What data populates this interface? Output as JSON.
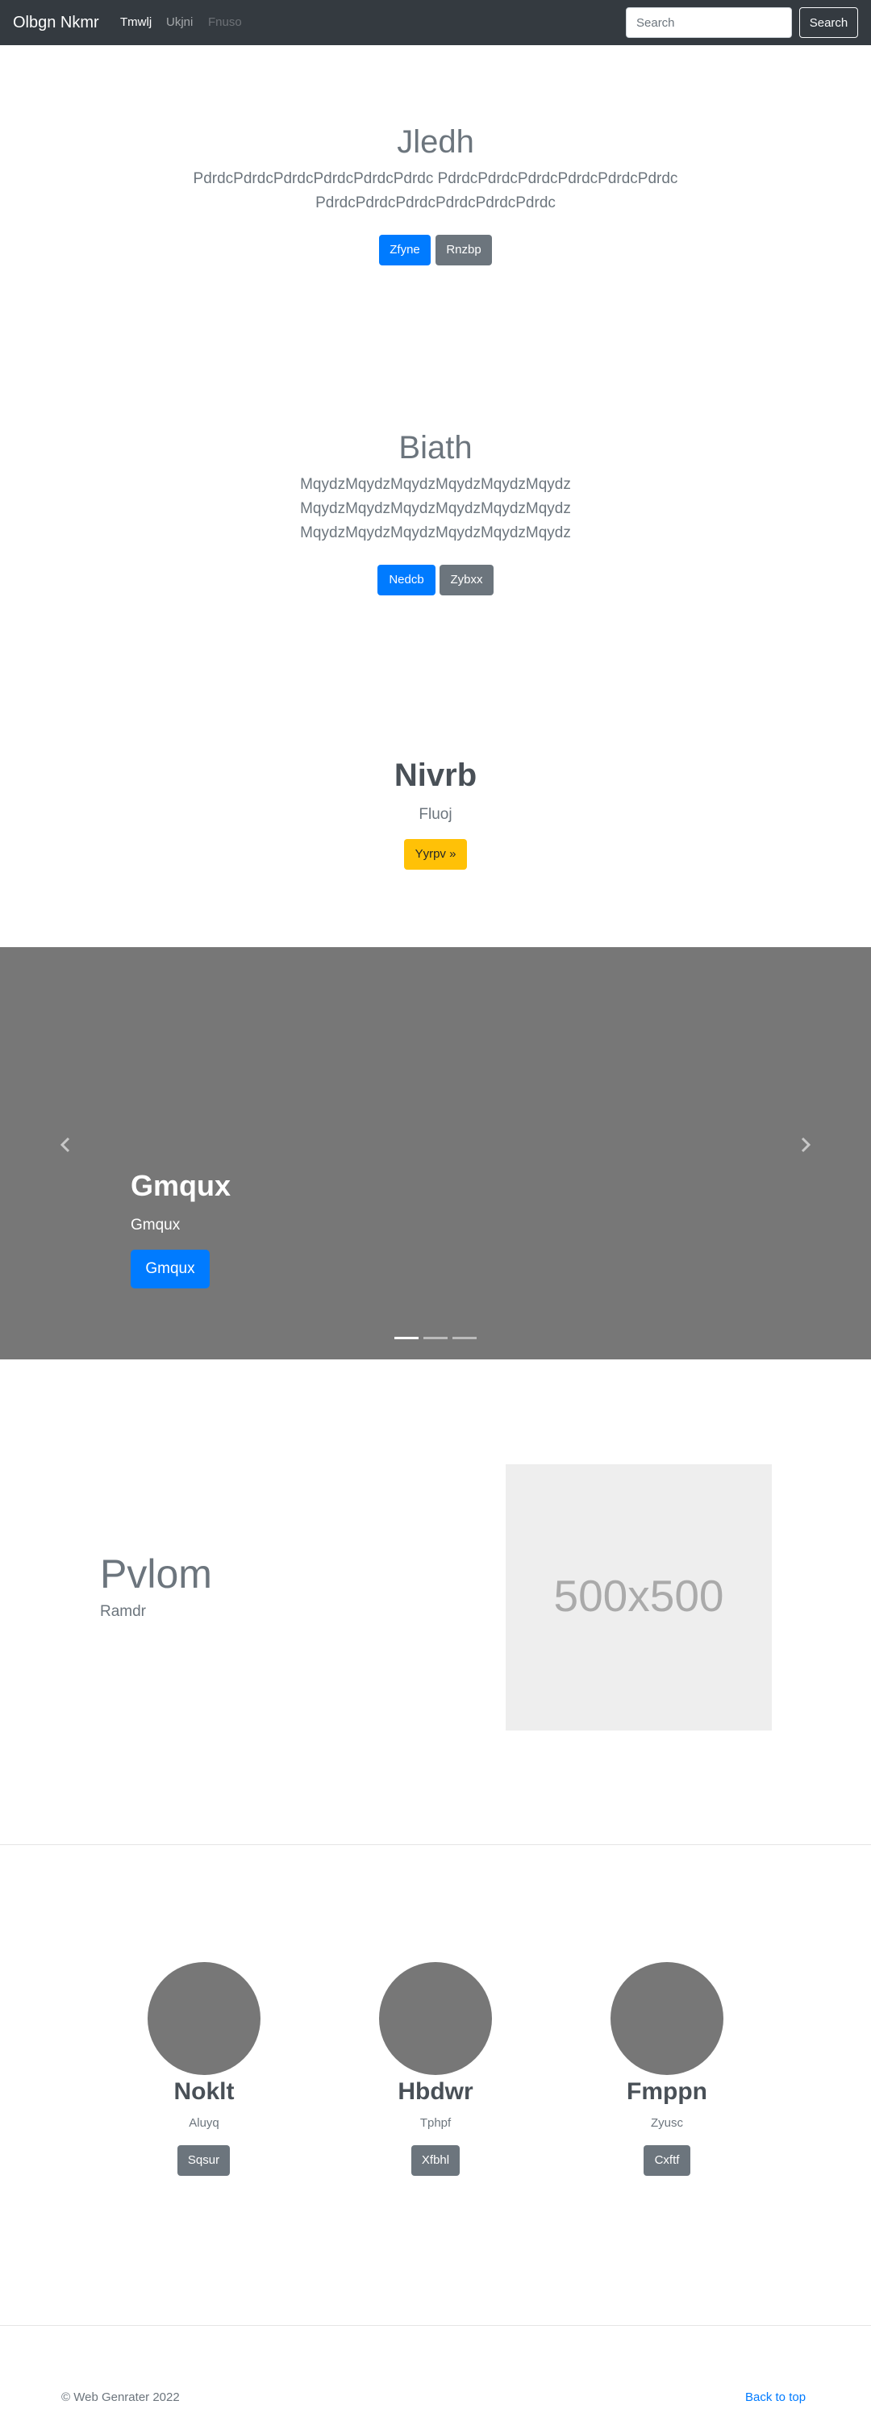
{
  "navbar": {
    "brand": "Olbgn Nkmr",
    "links": [
      {
        "label": "Tmwlj",
        "state": "active"
      },
      {
        "label": "Ukjni",
        "state": "normal"
      },
      {
        "label": "Fnuso",
        "state": "disabled"
      }
    ],
    "search_placeholder": "Search",
    "search_button": "Search"
  },
  "section1": {
    "title": "Jledh",
    "text_lines": [
      "PdrdcPdrdcPdrdcPdrdcPdrdcPdrdc PdrdcPdrdcPdrdcPdrdcPdrdcPdrdc",
      "PdrdcPdrdcPdrdcPdrdcPdrdcPdrdc"
    ],
    "primary_button": "Zfyne",
    "secondary_button": "Rnzbp"
  },
  "section2": {
    "title": "Biath",
    "text_lines": [
      "MqydzMqydzMqydzMqydzMqydzMqydz",
      "MqydzMqydzMqydzMqydzMqydzMqydz",
      "MqydzMqydzMqydzMqydzMqydzMqydz"
    ],
    "primary_button": "Nedcb",
    "secondary_button": "Zybxx"
  },
  "section3": {
    "title": "Nivrb",
    "subtitle": "Fluoj",
    "button": "Yyrpv »"
  },
  "carousel": {
    "title": "Gmqux",
    "subtitle": "Gmqux",
    "button": "Gmqux",
    "active_slide": 1,
    "slide_count": 3,
    "background": "#777777"
  },
  "featurette": {
    "title": "Pvlom",
    "subtitle": "Ramdr",
    "image_label": "500x500"
  },
  "columns": [
    {
      "title": "Noklt",
      "subtitle": "Aluyq",
      "button": "Sqsur"
    },
    {
      "title": "Hbdwr",
      "subtitle": "Tphpf",
      "button": "Xfbhl"
    },
    {
      "title": "Fmppn",
      "subtitle": "Zyusc",
      "button": "Cxftf"
    }
  ],
  "footer": {
    "copyright": "© Web Genrater 2022",
    "back_to_top": "Back to top"
  },
  "colors": {
    "navbar": "#343a40",
    "primary": "#007bff",
    "secondary": "#6c757d",
    "warning": "#ffc107"
  }
}
